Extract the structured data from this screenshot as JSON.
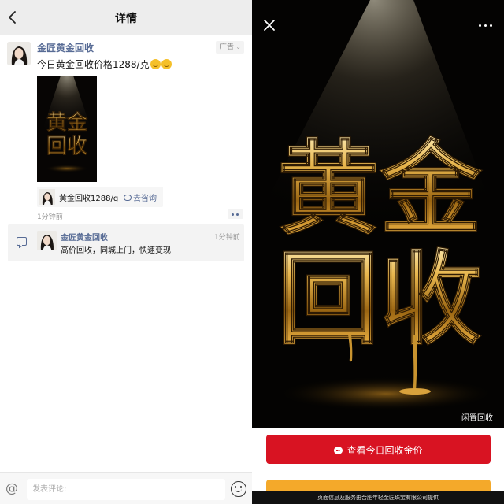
{
  "header": {
    "title": "详情",
    "back_icon": "chevron-left-icon"
  },
  "post": {
    "author": "金匠黄金回收",
    "ad_label": "广告",
    "text": "今日黄金回收价格1288/克",
    "emojis": [
      "smile-emoji",
      "smile-emoji"
    ],
    "image_text": [
      "黄金",
      "回收"
    ],
    "link_card": {
      "title": "黄金回收1288/g",
      "action": "去咨询"
    },
    "time": "1分钟前"
  },
  "comment": {
    "author": "金匠黄金回收",
    "time": "1分钟前",
    "text": "高价回收，同城上门，快速变现"
  },
  "input_bar": {
    "placeholder": "发表评论:",
    "value": ""
  },
  "ad_detail": {
    "hero_text": [
      "黄金",
      "回收"
    ],
    "watermark": "闲置回收",
    "cta_label": "查看今日回收金价",
    "footer": "页面信息及服务由合肥年轻金匠珠宝有限公司提供"
  },
  "colors": {
    "link_blue": "#576b95",
    "cta_red": "#d81322",
    "cta_orange": "#f4a92a",
    "gold": "#c8932f"
  }
}
